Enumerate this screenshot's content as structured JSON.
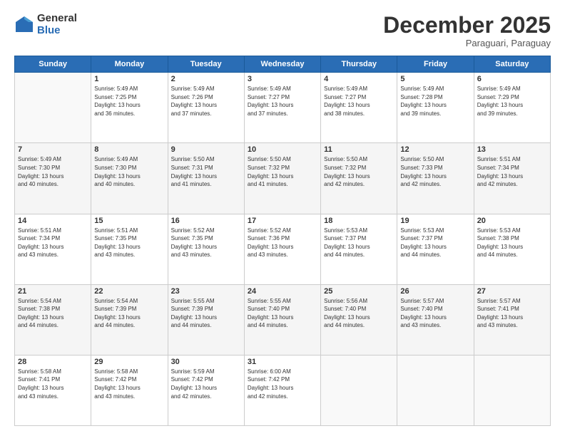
{
  "logo": {
    "general": "General",
    "blue": "Blue"
  },
  "header": {
    "month": "December 2025",
    "location": "Paraguari, Paraguay"
  },
  "days_of_week": [
    "Sunday",
    "Monday",
    "Tuesday",
    "Wednesday",
    "Thursday",
    "Friday",
    "Saturday"
  ],
  "weeks": [
    [
      {
        "day": "",
        "info": ""
      },
      {
        "day": "1",
        "info": "Sunrise: 5:49 AM\nSunset: 7:25 PM\nDaylight: 13 hours\nand 36 minutes."
      },
      {
        "day": "2",
        "info": "Sunrise: 5:49 AM\nSunset: 7:26 PM\nDaylight: 13 hours\nand 37 minutes."
      },
      {
        "day": "3",
        "info": "Sunrise: 5:49 AM\nSunset: 7:27 PM\nDaylight: 13 hours\nand 37 minutes."
      },
      {
        "day": "4",
        "info": "Sunrise: 5:49 AM\nSunset: 7:27 PM\nDaylight: 13 hours\nand 38 minutes."
      },
      {
        "day": "5",
        "info": "Sunrise: 5:49 AM\nSunset: 7:28 PM\nDaylight: 13 hours\nand 39 minutes."
      },
      {
        "day": "6",
        "info": "Sunrise: 5:49 AM\nSunset: 7:29 PM\nDaylight: 13 hours\nand 39 minutes."
      }
    ],
    [
      {
        "day": "7",
        "info": "Sunrise: 5:49 AM\nSunset: 7:30 PM\nDaylight: 13 hours\nand 40 minutes."
      },
      {
        "day": "8",
        "info": "Sunrise: 5:49 AM\nSunset: 7:30 PM\nDaylight: 13 hours\nand 40 minutes."
      },
      {
        "day": "9",
        "info": "Sunrise: 5:50 AM\nSunset: 7:31 PM\nDaylight: 13 hours\nand 41 minutes."
      },
      {
        "day": "10",
        "info": "Sunrise: 5:50 AM\nSunset: 7:32 PM\nDaylight: 13 hours\nand 41 minutes."
      },
      {
        "day": "11",
        "info": "Sunrise: 5:50 AM\nSunset: 7:32 PM\nDaylight: 13 hours\nand 42 minutes."
      },
      {
        "day": "12",
        "info": "Sunrise: 5:50 AM\nSunset: 7:33 PM\nDaylight: 13 hours\nand 42 minutes."
      },
      {
        "day": "13",
        "info": "Sunrise: 5:51 AM\nSunset: 7:34 PM\nDaylight: 13 hours\nand 42 minutes."
      }
    ],
    [
      {
        "day": "14",
        "info": "Sunrise: 5:51 AM\nSunset: 7:34 PM\nDaylight: 13 hours\nand 43 minutes."
      },
      {
        "day": "15",
        "info": "Sunrise: 5:51 AM\nSunset: 7:35 PM\nDaylight: 13 hours\nand 43 minutes."
      },
      {
        "day": "16",
        "info": "Sunrise: 5:52 AM\nSunset: 7:35 PM\nDaylight: 13 hours\nand 43 minutes."
      },
      {
        "day": "17",
        "info": "Sunrise: 5:52 AM\nSunset: 7:36 PM\nDaylight: 13 hours\nand 43 minutes."
      },
      {
        "day": "18",
        "info": "Sunrise: 5:53 AM\nSunset: 7:37 PM\nDaylight: 13 hours\nand 44 minutes."
      },
      {
        "day": "19",
        "info": "Sunrise: 5:53 AM\nSunset: 7:37 PM\nDaylight: 13 hours\nand 44 minutes."
      },
      {
        "day": "20",
        "info": "Sunrise: 5:53 AM\nSunset: 7:38 PM\nDaylight: 13 hours\nand 44 minutes."
      }
    ],
    [
      {
        "day": "21",
        "info": "Sunrise: 5:54 AM\nSunset: 7:38 PM\nDaylight: 13 hours\nand 44 minutes."
      },
      {
        "day": "22",
        "info": "Sunrise: 5:54 AM\nSunset: 7:39 PM\nDaylight: 13 hours\nand 44 minutes."
      },
      {
        "day": "23",
        "info": "Sunrise: 5:55 AM\nSunset: 7:39 PM\nDaylight: 13 hours\nand 44 minutes."
      },
      {
        "day": "24",
        "info": "Sunrise: 5:55 AM\nSunset: 7:40 PM\nDaylight: 13 hours\nand 44 minutes."
      },
      {
        "day": "25",
        "info": "Sunrise: 5:56 AM\nSunset: 7:40 PM\nDaylight: 13 hours\nand 44 minutes."
      },
      {
        "day": "26",
        "info": "Sunrise: 5:57 AM\nSunset: 7:40 PM\nDaylight: 13 hours\nand 43 minutes."
      },
      {
        "day": "27",
        "info": "Sunrise: 5:57 AM\nSunset: 7:41 PM\nDaylight: 13 hours\nand 43 minutes."
      }
    ],
    [
      {
        "day": "28",
        "info": "Sunrise: 5:58 AM\nSunset: 7:41 PM\nDaylight: 13 hours\nand 43 minutes."
      },
      {
        "day": "29",
        "info": "Sunrise: 5:58 AM\nSunset: 7:42 PM\nDaylight: 13 hours\nand 43 minutes."
      },
      {
        "day": "30",
        "info": "Sunrise: 5:59 AM\nSunset: 7:42 PM\nDaylight: 13 hours\nand 42 minutes."
      },
      {
        "day": "31",
        "info": "Sunrise: 6:00 AM\nSunset: 7:42 PM\nDaylight: 13 hours\nand 42 minutes."
      },
      {
        "day": "",
        "info": ""
      },
      {
        "day": "",
        "info": ""
      },
      {
        "day": "",
        "info": ""
      }
    ]
  ]
}
